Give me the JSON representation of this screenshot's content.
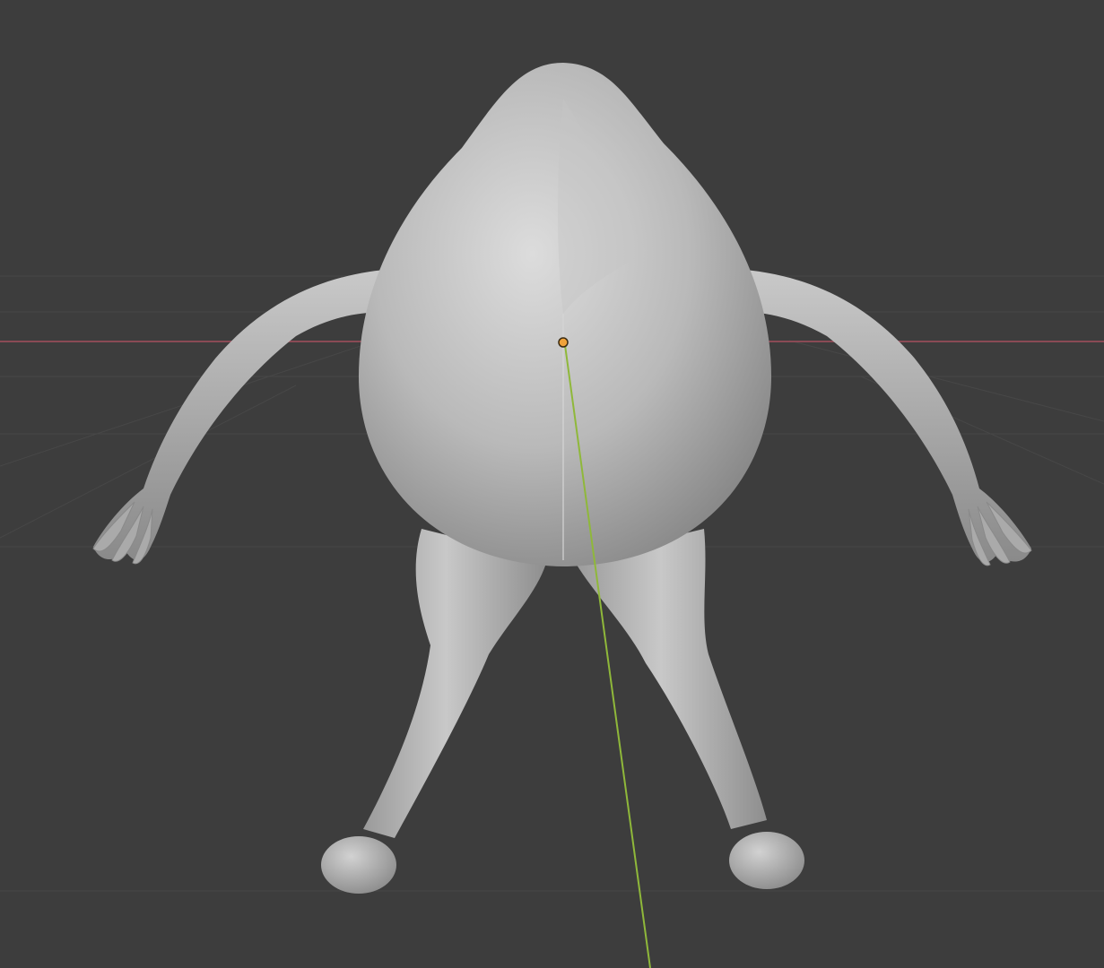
{
  "viewport": {
    "background_color": "#3d3d3d",
    "grid_line_color": "#474747",
    "x_axis_color": "#8a4a55",
    "y_axis_color": "#8fb83a",
    "origin_marker_color": "#f0a23a",
    "mesh_base_color": "#b8b8b8",
    "mesh_highlight_color": "#d9d9d9",
    "mesh_shadow_color": "#7c7c7c"
  },
  "scene": {
    "object": "sculpted-creature-mesh",
    "shading": "solid",
    "visible_text": []
  }
}
